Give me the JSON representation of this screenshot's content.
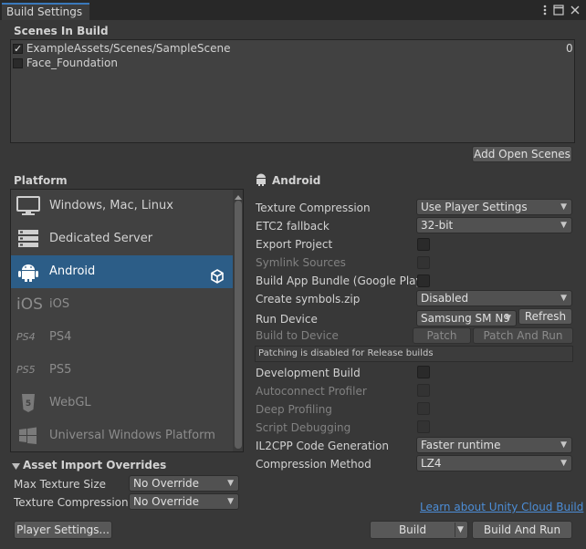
{
  "window": {
    "tab_title": "Build Settings",
    "icons": [
      "more-icon",
      "maximize-icon",
      "close-icon"
    ]
  },
  "scenes": {
    "header": "Scenes In Build",
    "items": [
      {
        "name": "ExampleAssets/Scenes/SampleScene",
        "checked": true,
        "index": "0"
      },
      {
        "name": "Face_Foundation",
        "checked": false,
        "index": ""
      }
    ],
    "add_open_scenes": "Add Open Scenes"
  },
  "platform": {
    "header": "Platform",
    "items": [
      {
        "label": "Windows, Mac, Linux",
        "icon": "monitor-icon",
        "state": "normal"
      },
      {
        "label": "Dedicated Server",
        "icon": "server-icon",
        "state": "normal"
      },
      {
        "label": "Android",
        "icon": "android-icon",
        "state": "selected"
      },
      {
        "label": "iOS",
        "icon": "ios-icon",
        "state": "dim"
      },
      {
        "label": "PS4",
        "icon": "ps4-icon",
        "state": "dim"
      },
      {
        "label": "PS5",
        "icon": "ps5-icon",
        "state": "dim"
      },
      {
        "label": "WebGL",
        "icon": "html5-icon",
        "state": "dim"
      },
      {
        "label": "Universal Windows Platform",
        "icon": "windows-icon",
        "state": "dim"
      }
    ]
  },
  "android": {
    "title": "Android",
    "texture_compression": {
      "label": "Texture Compression",
      "value": "Use Player Settings"
    },
    "etc2_fallback": {
      "label": "ETC2 fallback",
      "value": "32-bit"
    },
    "export_project": {
      "label": "Export Project"
    },
    "symlink_sources": {
      "label": "Symlink Sources"
    },
    "build_app_bundle": {
      "label": "Build App Bundle (Google Play)"
    },
    "create_symbols": {
      "label": "Create symbols.zip",
      "value": "Disabled"
    },
    "run_device": {
      "label": "Run Device",
      "value": "Samsung SM N9",
      "refresh": "Refresh"
    },
    "build_to_device": {
      "label": "Build to Device",
      "patch": "Patch",
      "patch_and_run": "Patch And Run"
    },
    "patching_note": "Patching is disabled for Release builds",
    "development_build": {
      "label": "Development Build"
    },
    "autoconnect_profiler": {
      "label": "Autoconnect Profiler"
    },
    "deep_profiling": {
      "label": "Deep Profiling"
    },
    "script_debugging": {
      "label": "Script Debugging"
    },
    "il2cpp": {
      "label": "IL2CPP Code Generation",
      "value": "Faster runtime"
    },
    "compression": {
      "label": "Compression Method",
      "value": "LZ4"
    }
  },
  "asset_import": {
    "header": "Asset Import Overrides",
    "max_texture_size": {
      "label": "Max Texture Size",
      "value": "No Override"
    },
    "texture_compression": {
      "label": "Texture Compression",
      "value": "No Override"
    }
  },
  "footer": {
    "cloud_link": "Learn about Unity Cloud Build",
    "player_settings": "Player Settings...",
    "build": "Build",
    "build_and_run": "Build And Run"
  },
  "colors": {
    "accent": "#2c5d87",
    "background": "#383838",
    "link": "#4c8dd6"
  }
}
